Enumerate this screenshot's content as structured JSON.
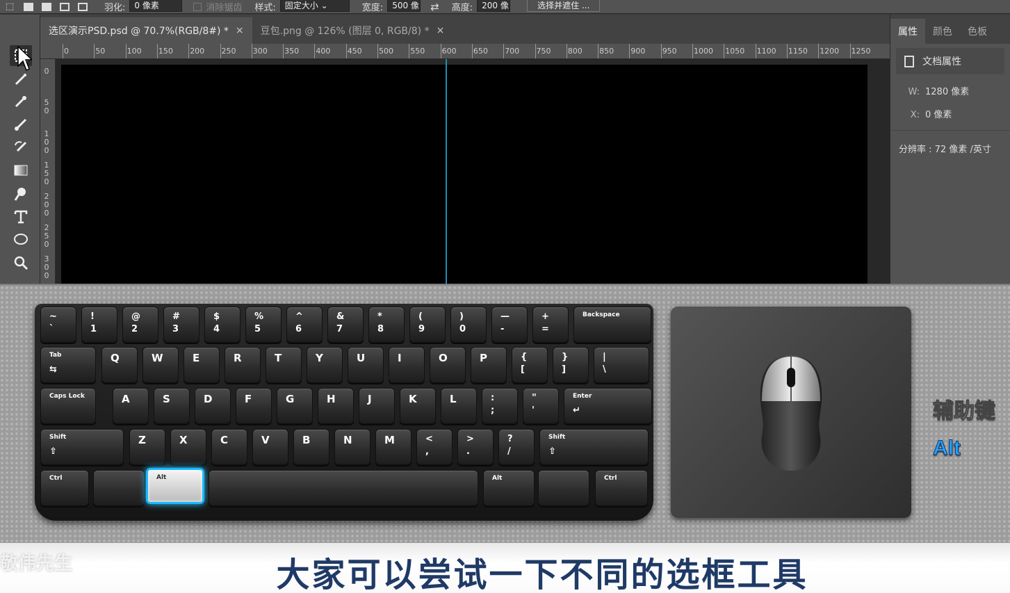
{
  "options_bar": {
    "feather_label": "羽化:",
    "feather_value": "0 像素",
    "antialias_label": "消除锯齿",
    "style_label": "样式:",
    "style_value": "固定大小",
    "width_label": "宽度:",
    "width_value": "500 像",
    "height_label": "高度:",
    "height_value": "200 像",
    "select_mask_button": "选择并遮住 ..."
  },
  "tabs": [
    {
      "label": "选区演示PSD.psd @ 70.7%(RGB/8#) *",
      "close": "×"
    },
    {
      "label": "豆包.png @ 126% (图层 0, RGB/8) *",
      "close": "×"
    }
  ],
  "ruler_h": [
    "0",
    "50",
    "100",
    "150",
    "200",
    "250",
    "300",
    "350",
    "400",
    "450",
    "500",
    "550",
    "600",
    "650",
    "700",
    "750",
    "800",
    "850",
    "900",
    "950",
    "1000",
    "1050",
    "1100",
    "1150",
    "1200",
    "1250"
  ],
  "ruler_v": [
    [
      "0"
    ],
    [
      "5",
      "0"
    ],
    [
      "1",
      "0",
      "0"
    ],
    [
      "1",
      "5",
      "0"
    ],
    [
      "2",
      "0",
      "0"
    ],
    [
      "2",
      "5",
      "0"
    ],
    [
      "3",
      "0",
      "0"
    ]
  ],
  "panel": {
    "tabs": [
      "属性",
      "颜色",
      "色板"
    ],
    "doc_props": "文档属性",
    "w_label": "W:",
    "w_value": "1280 像素",
    "x_label": "X:",
    "x_value": "0 像素",
    "resolution": "分辨率 : 72 像素 /英寸"
  },
  "keyboard": {
    "row1": [
      [
        "~",
        "`"
      ],
      [
        "!",
        "1"
      ],
      [
        "@",
        "2"
      ],
      [
        "#",
        "3"
      ],
      [
        "$",
        "4"
      ],
      [
        "%",
        "5"
      ],
      [
        "^",
        "6"
      ],
      [
        "&",
        "7"
      ],
      [
        "*",
        "8"
      ],
      [
        "(",
        "9"
      ],
      [
        ")",
        "0"
      ],
      [
        "—",
        "-"
      ],
      [
        "+",
        "="
      ]
    ],
    "backspace": "Backspace",
    "tab": "Tab",
    "row2": [
      "Q",
      "W",
      "E",
      "R",
      "T",
      "Y",
      "U",
      "I",
      "O",
      "P"
    ],
    "row2_sym": [
      [
        "{",
        "["
      ],
      [
        "}",
        "]"
      ],
      [
        "|",
        "\\"
      ]
    ],
    "caps": "Caps Lock",
    "row3": [
      "A",
      "S",
      "D",
      "F",
      "G",
      "H",
      "J",
      "K",
      "L"
    ],
    "row3_sym": [
      [
        ":",
        ";"
      ],
      [
        "\"",
        "'"
      ]
    ],
    "enter": "Enter",
    "shift": "Shift",
    "row4": [
      "Z",
      "X",
      "C",
      "V",
      "B",
      "N",
      "M"
    ],
    "row4_sym": [
      [
        "<",
        ","
      ],
      [
        ">",
        "."
      ],
      [
        "?",
        "/"
      ]
    ],
    "ctrl": "Ctrl",
    "alt": "Alt"
  },
  "side_label": "辅助键",
  "side_key": "Alt",
  "subtitle": "大家可以尝试一下不同的选框工具",
  "watermark": "敬伟先生"
}
